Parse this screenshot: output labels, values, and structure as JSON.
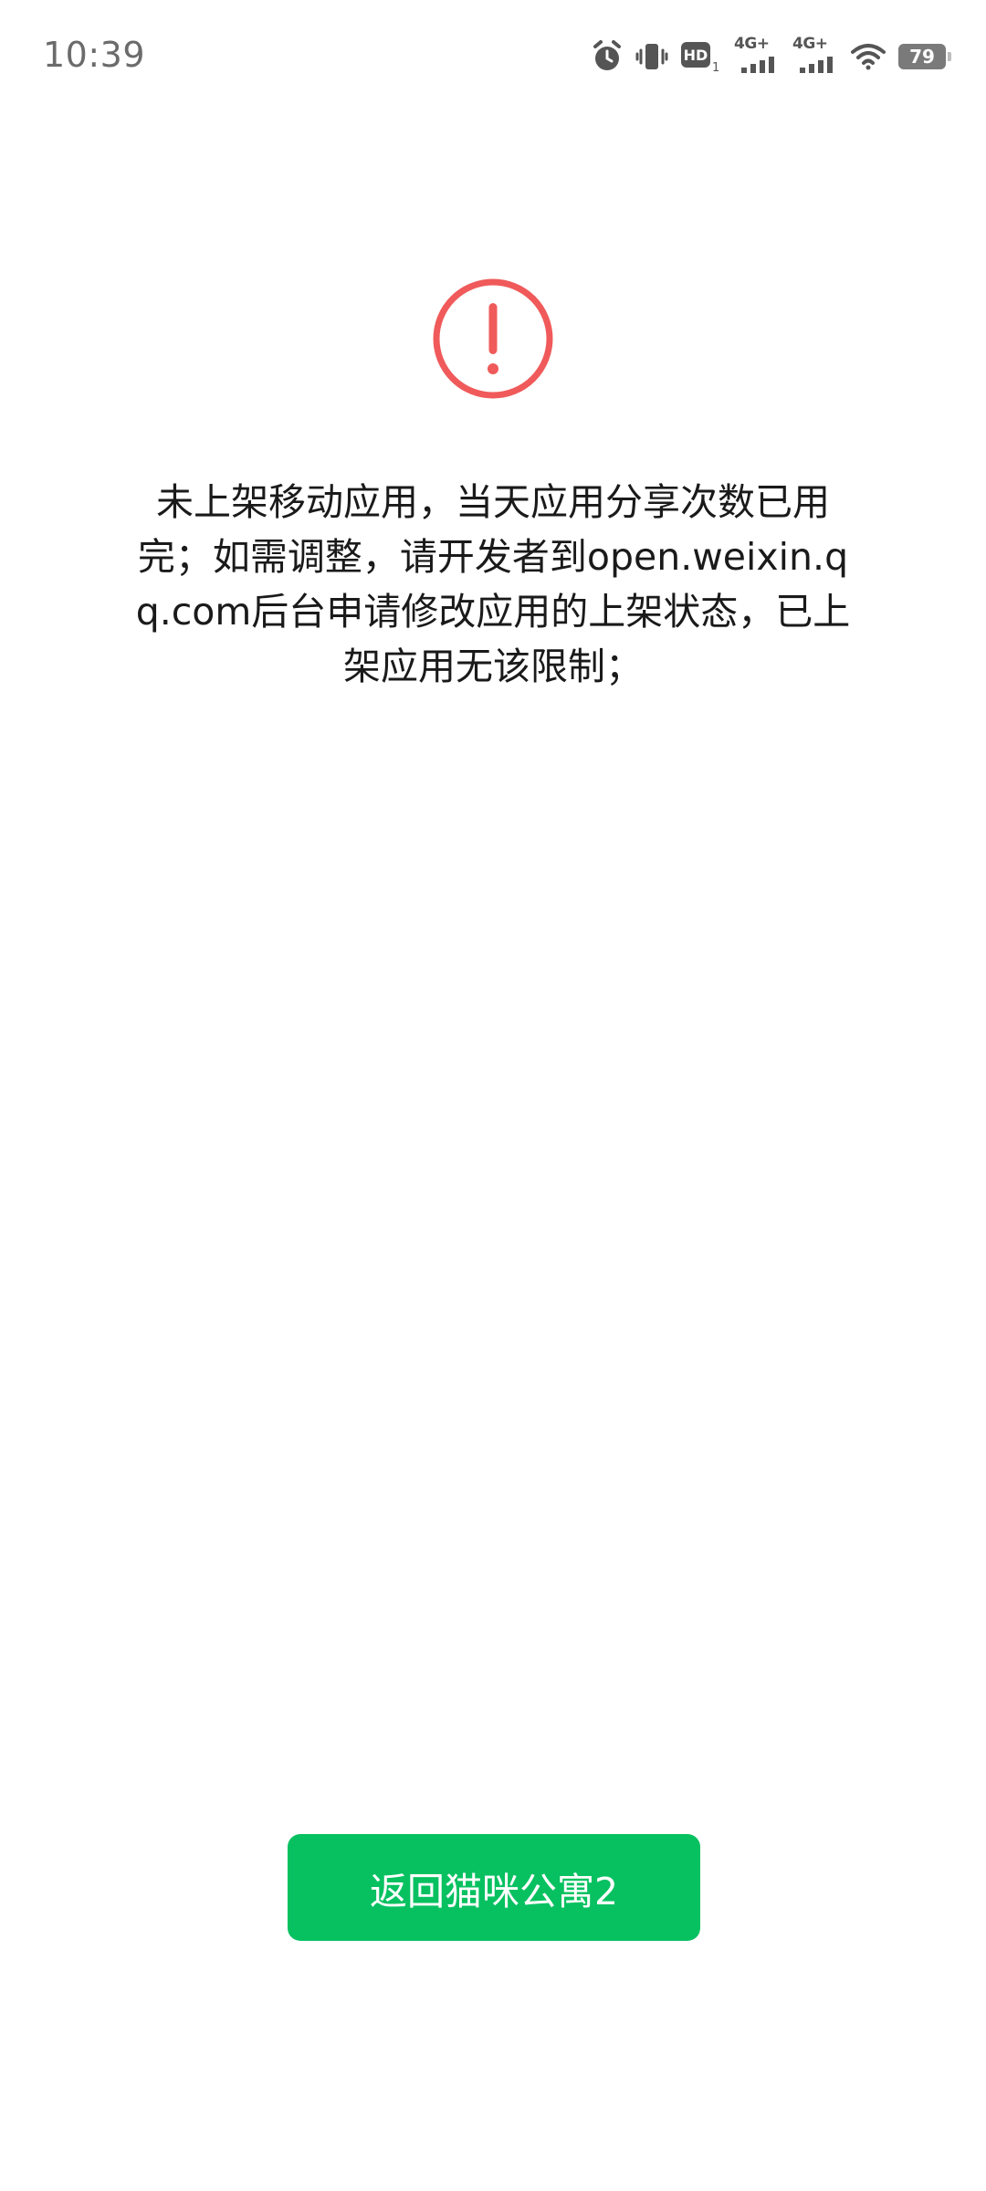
{
  "status_bar": {
    "time": "10:39",
    "icons": [
      "alarm-icon",
      "vibrate-icon",
      "hd-icon",
      "signal-4g-icon",
      "signal-4g-icon",
      "wifi-icon",
      "battery-icon"
    ],
    "hd_label": "HD",
    "hd_sub": "1",
    "network_1": "4G+",
    "network_2": "4G+",
    "battery_level": "79"
  },
  "main": {
    "icon": "warning-circle-icon",
    "icon_color": "#f05a5a",
    "message": "未上架移动应用，当天应用分享次数已用完；如需调整，请开发者到open.weixin.qq.com后台申请修改应用的上架状态，已上架应用无该限制；",
    "return_button_label": "返回猫咪公寓2",
    "button_color": "#07c160"
  }
}
